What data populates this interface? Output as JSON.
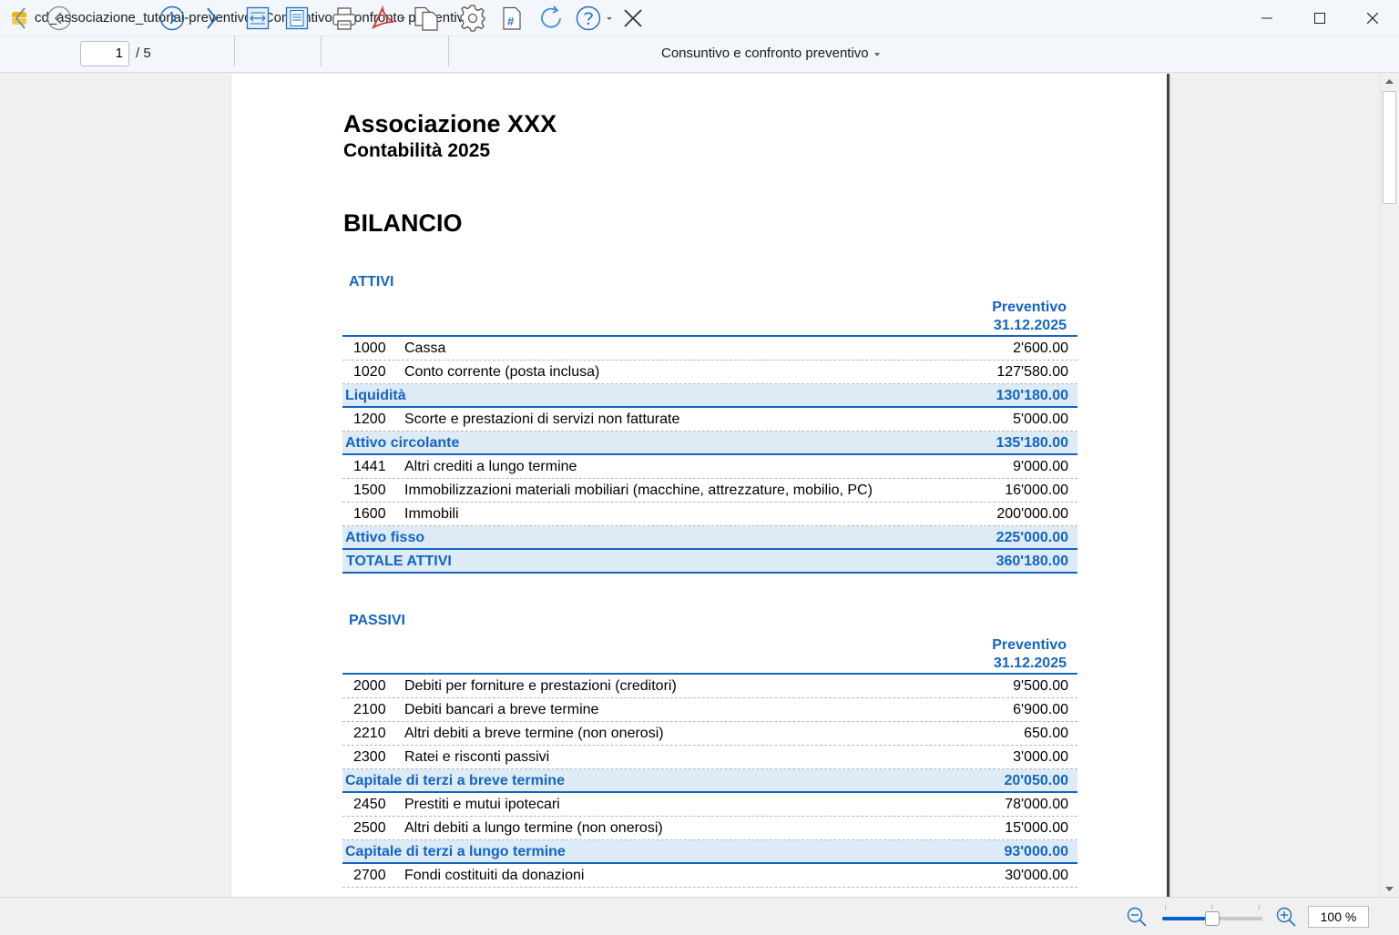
{
  "window": {
    "title": "cd_associazione_tutorial-preventivo - Consuntivo e confronto preventivo"
  },
  "toolbar": {
    "page_current": "1",
    "page_total": "/ 5",
    "report_name": "Consuntivo e confronto preventivo"
  },
  "report": {
    "organization": "Associazione XXX",
    "subtitle": "Contabilità 2025",
    "title": "BILANCIO",
    "column_header": [
      "Preventivo",
      "31.12.2025"
    ],
    "attivi": {
      "heading": "ATTIVI",
      "rows": [
        {
          "acc": "1000",
          "desc": "Cassa",
          "amt": "2'600.00",
          "kind": "line"
        },
        {
          "acc": "1020",
          "desc": "Conto corrente (posta inclusa)",
          "amt": "127'580.00",
          "kind": "line"
        },
        {
          "acc": "",
          "desc": "Liquidità",
          "amt": "130'180.00",
          "kind": "total"
        },
        {
          "acc": "1200",
          "desc": "Scorte e prestazioni di servizi non fatturate",
          "amt": "5'000.00",
          "kind": "line"
        },
        {
          "acc": "",
          "desc": "Attivo circolante",
          "amt": "135'180.00",
          "kind": "total"
        },
        {
          "acc": "1441",
          "desc": "Altri crediti a lungo termine",
          "amt": "9'000.00",
          "kind": "line"
        },
        {
          "acc": "1500",
          "desc": "Immobilizzazioni materiali mobiliari (macchine, attrezzature, mobilio, PC)",
          "amt": "16'000.00",
          "kind": "line"
        },
        {
          "acc": "1600",
          "desc": "Immobili",
          "amt": "200'000.00",
          "kind": "line"
        },
        {
          "acc": "",
          "desc": "Attivo fisso",
          "amt": "225'000.00",
          "kind": "total"
        },
        {
          "acc": "",
          "desc": "TOTALE ATTIVI",
          "amt": "360'180.00",
          "kind": "grand"
        }
      ]
    },
    "passivi": {
      "heading": "PASSIVI",
      "rows": [
        {
          "acc": "2000",
          "desc": "Debiti per forniture e prestazioni (creditori)",
          "amt": "9'500.00",
          "kind": "line"
        },
        {
          "acc": "2100",
          "desc": "Debiti bancari a breve termine",
          "amt": "6'900.00",
          "kind": "line"
        },
        {
          "acc": "2210",
          "desc": "Altri debiti a breve termine (non onerosi)",
          "amt": "650.00",
          "kind": "line"
        },
        {
          "acc": "2300",
          "desc": "Ratei e risconti passivi",
          "amt": "3'000.00",
          "kind": "line"
        },
        {
          "acc": "",
          "desc": "Capitale di terzi a breve termine",
          "amt": "20'050.00",
          "kind": "total"
        },
        {
          "acc": "2450",
          "desc": "Prestiti e mutui ipotecari",
          "amt": "78'000.00",
          "kind": "line"
        },
        {
          "acc": "2500",
          "desc": "Altri debiti a lungo termine (non onerosi)",
          "amt": "15'000.00",
          "kind": "line"
        },
        {
          "acc": "",
          "desc": "Capitale di terzi a lungo termine",
          "amt": "93'000.00",
          "kind": "total"
        },
        {
          "acc": "2700",
          "desc": "Fondi costituiti da donazioni",
          "amt": "30'000.00",
          "kind": "line"
        }
      ]
    }
  },
  "status": {
    "zoom": "100 %",
    "zoom_slider_fraction": 0.5
  }
}
